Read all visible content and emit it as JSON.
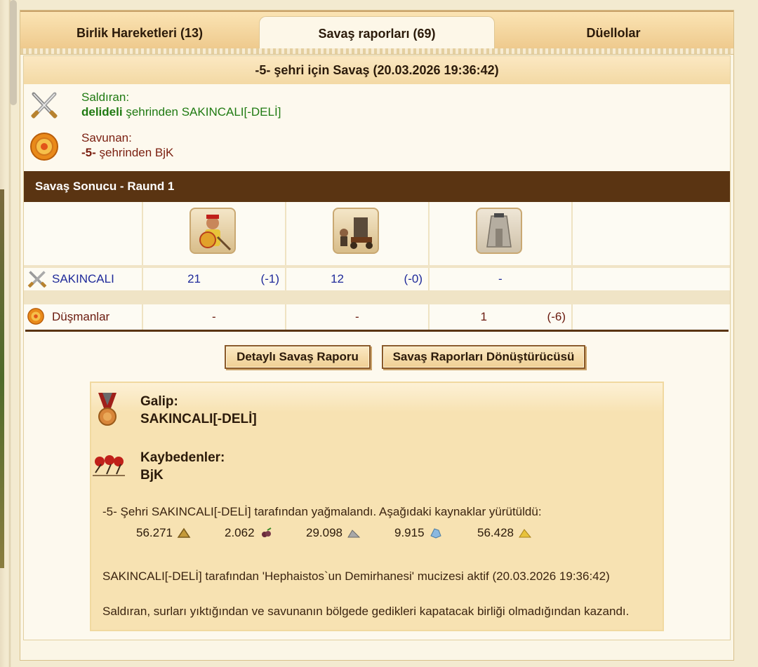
{
  "tabs": [
    {
      "label": "Birlik Hareketleri (13)",
      "active": false
    },
    {
      "label": "Savaş raporları (69)",
      "active": true
    },
    {
      "label": "Düellolar",
      "active": false
    }
  ],
  "report": {
    "title": "-5- şehri için Savaş (20.03.2026 19:36:42)",
    "attacker": {
      "heading": "Saldıran:",
      "city": "delideli",
      "rest": "şehrinden SAKINCALI[-DELİ]"
    },
    "defender": {
      "heading": "Savunan:",
      "city": "-5-",
      "rest": "şehrinden BjK"
    },
    "round_title": "Savaş Sonucu - Raund 1",
    "units": [
      "hoplite-unit",
      "catapult-unit",
      "city-wall-unit"
    ],
    "rows": [
      {
        "label": "SAKINCALI",
        "values": [
          "21",
          "(-1)",
          "12",
          "(-0)",
          "-"
        ]
      },
      {
        "label": "Düşmanlar",
        "values": [
          "-",
          "-",
          "1",
          "(-6)"
        ]
      }
    ],
    "buttons": {
      "detailed": "Detaylı Savaş Raporu",
      "converter": "Savaş Raporları Dönüştürücüsü"
    },
    "result": {
      "winner_label": "Galip:",
      "winner": "SAKINCALI[-DELİ]",
      "losers_label": "Kaybedenler:",
      "losers": "BjK",
      "plunder_text": "-5- Şehri SAKINCALI[-DELİ] tarafından yağmalandı. Aşağıdaki kaynaklar yürütüldü:",
      "resources": [
        {
          "value": "56.271",
          "icon": "wood-icon"
        },
        {
          "value": "2.062",
          "icon": "wine-icon"
        },
        {
          "value": "29.098",
          "icon": "marble-icon"
        },
        {
          "value": "9.915",
          "icon": "crystal-icon"
        },
        {
          "value": "56.428",
          "icon": "sulfur-icon"
        }
      ],
      "wonder_text": "SAKINCALI[-DELİ] tarafından 'Hephaistos`un Demirhanesi' mucizesi aktif (20.03.2026 19:36:42)",
      "reason_text": "Saldıran, surları yıktığından ve savunanın bölgede gedikleri kapatacak birliği olmadığından kazandı."
    }
  },
  "colors": {
    "accent_bar": "#5a3412",
    "attacker": "#1f7a12",
    "defender": "#7a1f10",
    "unit_count": "#1f2a9a"
  }
}
